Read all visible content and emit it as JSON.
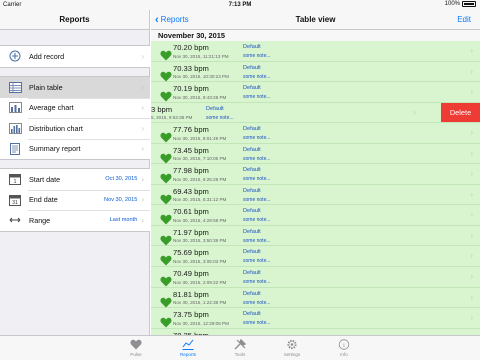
{
  "status_bar": {
    "carrier": "Carrier",
    "time": "7:13 PM",
    "battery": "100%"
  },
  "master": {
    "title": "Reports",
    "group1": [
      {
        "label": "Add record",
        "icon": "add-circle-icon"
      }
    ],
    "group2": [
      {
        "label": "Plain table",
        "icon": "table-icon"
      },
      {
        "label": "Average chart",
        "icon": "bar-chart-icon"
      },
      {
        "label": "Distribution chart",
        "icon": "distribution-chart-icon"
      },
      {
        "label": "Summary report",
        "icon": "report-icon"
      }
    ],
    "group3": [
      {
        "label": "Start date",
        "value": "Oct 30, 2015",
        "icon": "calendar-start-icon"
      },
      {
        "label": "End date",
        "value": "Nov 30, 2015",
        "icon": "calendar-end-icon"
      },
      {
        "label": "Range",
        "value": "Last month",
        "icon": "range-icon"
      }
    ]
  },
  "detail": {
    "back_label": "Reports",
    "title": "Table view",
    "edit_label": "Edit",
    "section_header": "November 30, 2015",
    "delete_label": "Delete",
    "rows": [
      {
        "bpm": "70.20 bpm",
        "date": "Nov 30, 2015, 11:21:13 PM",
        "kind": "Default",
        "note": "some note..."
      },
      {
        "bpm": "70.33 bpm",
        "date": "Nov 30, 2015, 10:30:23 PM",
        "kind": "Default",
        "note": "some note..."
      },
      {
        "bpm": "70.19 bpm",
        "date": "Nov 30, 2015, 9:43:28 PM",
        "kind": "Default",
        "note": "some note..."
      },
      {
        "bpm": "3 bpm",
        "date": "5, 2015, 9:53:38 PM",
        "kind": "Default",
        "note": "some note..."
      },
      {
        "bpm": "77.76 bpm",
        "date": "Nov 30, 2015, 8:01:49 PM",
        "kind": "Default",
        "note": "some note..."
      },
      {
        "bpm": "73.45 bpm",
        "date": "Nov 30, 2015, 7:10:05 PM",
        "kind": "Default",
        "note": "some note..."
      },
      {
        "bpm": "77.98 bpm",
        "date": "Nov 30, 2015, 6:25:28 PM",
        "kind": "Default",
        "note": "some note..."
      },
      {
        "bpm": "69.43 bpm",
        "date": "Nov 30, 2015, 5:31:12 PM",
        "kind": "Default",
        "note": "some note..."
      },
      {
        "bpm": "70.61 bpm",
        "date": "Nov 30, 2015, 4:29:58 PM",
        "kind": "Default",
        "note": "some note..."
      },
      {
        "bpm": "71.97 bpm",
        "date": "Nov 30, 2015, 3:50:39 PM",
        "kind": "Default",
        "note": "some note..."
      },
      {
        "bpm": "75.69 bpm",
        "date": "Nov 30, 2015, 3:05:03 PM",
        "kind": "Default",
        "note": "some note..."
      },
      {
        "bpm": "70.49 bpm",
        "date": "Nov 30, 2015, 2:09:22 PM",
        "kind": "Default",
        "note": "some note..."
      },
      {
        "bpm": "81.81 bpm",
        "date": "Nov 30, 2015, 1:22:38 PM",
        "kind": "Default",
        "note": "some note..."
      },
      {
        "bpm": "73.75 bpm",
        "date": "Nov 30, 2015, 12:29:06 PM",
        "kind": "Default",
        "note": "some note..."
      },
      {
        "bpm": "78.25 bpm",
        "date": "",
        "kind": "",
        "note": ""
      }
    ]
  },
  "tabbar": [
    {
      "label": "Pulse",
      "icon": "heart-icon"
    },
    {
      "label": "Reports",
      "icon": "chart-icon",
      "active": true
    },
    {
      "label": "Tools",
      "icon": "tools-icon"
    },
    {
      "label": "Settings",
      "icon": "gear-icon"
    },
    {
      "label": "Info",
      "icon": "info-icon"
    }
  ],
  "colors": {
    "accent": "#0a7aff",
    "row_bg": "#d9f5d0",
    "heart": "#3a9d2a",
    "delete": "#ee3b33"
  }
}
